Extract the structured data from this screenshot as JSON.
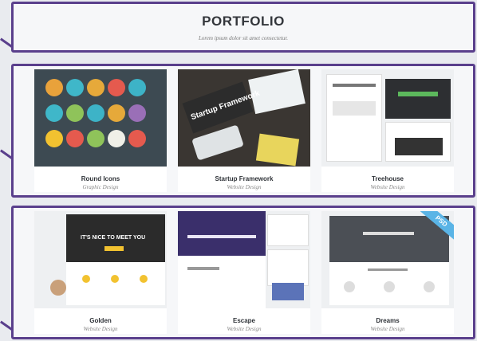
{
  "header": {
    "title": "PORTFOLIO",
    "subtitle": "Lorem ipsum dolor sit amet consectetur."
  },
  "row1": [
    {
      "name": "Round Icons",
      "category": "Graphic Design"
    },
    {
      "name": "Startup Framework",
      "category": "Website Design"
    },
    {
      "name": "Treehouse",
      "category": "Website Design"
    }
  ],
  "row2": [
    {
      "name": "Golden",
      "category": "Website Design"
    },
    {
      "name": "Escape",
      "category": "Website Design"
    },
    {
      "name": "Dreams",
      "category": "Website Design"
    }
  ],
  "thumb_text": {
    "startup": "Startup Framework",
    "golden": "IT'S NICE TO MEET YOU",
    "badge": "PSD"
  },
  "colors": {
    "frame": "#5a3f8c",
    "page_bg": "#e9ebef"
  }
}
